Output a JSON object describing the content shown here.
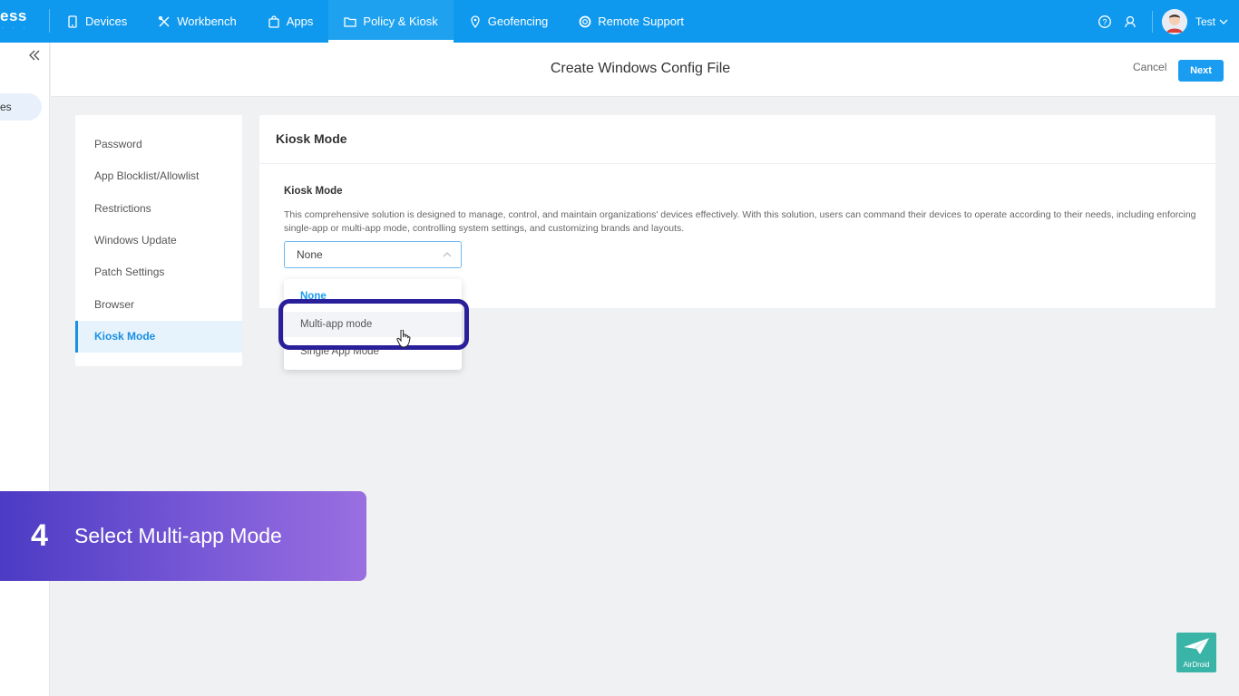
{
  "brand": {
    "text": "ess",
    "sub": "· · ·"
  },
  "nav": {
    "items": [
      {
        "label": "Devices",
        "icon": "tablet-icon"
      },
      {
        "label": "Workbench",
        "icon": "tools-icon"
      },
      {
        "label": "Apps",
        "icon": "bag-icon"
      },
      {
        "label": "Policy & Kiosk",
        "icon": "folder-icon",
        "active": true
      },
      {
        "label": "Geofencing",
        "icon": "location-icon"
      },
      {
        "label": "Remote Support",
        "icon": "lifebuoy-icon"
      }
    ]
  },
  "user": {
    "name": "Test"
  },
  "sidebar": {
    "partial_label": "es"
  },
  "header": {
    "title": "Create Windows Config File",
    "cancel": "Cancel",
    "next": "Next"
  },
  "menu": {
    "items": [
      "Password",
      "App Blocklist/Allowlist",
      "Restrictions",
      "Windows Update",
      "Patch Settings",
      "Browser",
      "Kiosk Mode"
    ],
    "active": "Kiosk Mode"
  },
  "content": {
    "title": "Kiosk Mode",
    "field_label": "Kiosk Mode",
    "description": "This comprehensive solution is designed to manage, control, and maintain organizations' devices effectively. With this solution, users can command their devices to operate according to their needs, including enforcing single-app or multi-app mode, controlling system settings, and customizing brands and layouts.",
    "select_value": "None"
  },
  "dropdown": {
    "options": [
      "None",
      "Multi-app mode",
      "Single App Mode"
    ],
    "selected": "None",
    "hovered": "Multi-app mode"
  },
  "banner": {
    "number": "4",
    "text": "Select Multi-app Mode"
  },
  "watermark": {
    "text": "AirDroid"
  },
  "colors": {
    "primary": "#0f99ee",
    "highlight": "#2a1f9b",
    "banner_start": "#4c3bc4",
    "banner_end": "#9a6fe0"
  }
}
